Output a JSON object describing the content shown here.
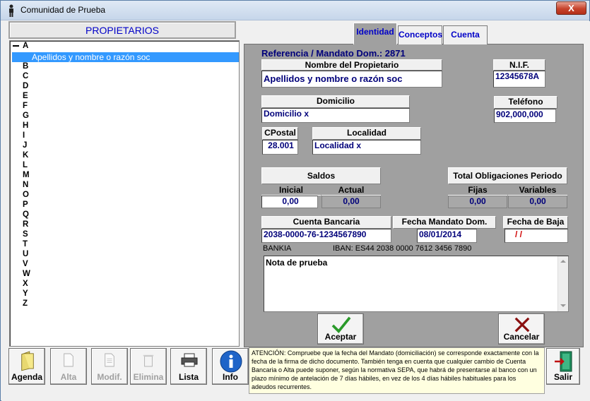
{
  "window": {
    "title": "Comunidad de Prueba",
    "close_label": "X"
  },
  "propietarios": {
    "header": "PROPIETARIOS",
    "root_letter": "A",
    "selected_item": "Apellidos y nombre o razón soc",
    "letters": [
      "B",
      "C",
      "D",
      "E",
      "F",
      "G",
      "H",
      "I",
      "J",
      "K",
      "L",
      "M",
      "N",
      "O",
      "P",
      "Q",
      "R",
      "S",
      "T",
      "U",
      "V",
      "W",
      "X",
      "Y",
      "Z"
    ]
  },
  "tabs": {
    "identidad": "Identidad",
    "conceptos": "Conceptos",
    "cuenta": "Cuenta"
  },
  "form": {
    "referencia": "Referencia / Mandato Dom.:  2871",
    "nombre_label": "Nombre del Propietario",
    "nombre_value": "Apellidos y nombre o razón soc",
    "nif_label": "N.I.F.",
    "nif_value": "12345678A",
    "domicilio_label": "Domicilio",
    "domicilio_value": "Domicilio x",
    "telefono_label": "Teléfono",
    "telefono_value": "902,000,000",
    "cpostal_label": "CPostal",
    "cpostal_value": "28.001",
    "localidad_label": "Localidad",
    "localidad_value": "Localidad x",
    "saldos_label": "Saldos",
    "inicial_label": "Inicial",
    "inicial_value": "0,00",
    "actual_label": "Actual",
    "actual_value": "0,00",
    "obligaciones_label": "Total Obligaciones Periodo",
    "fijas_label": "Fijas",
    "fijas_value": "0,00",
    "variables_label": "Variables",
    "variables_value": "0,00",
    "cuenta_label": "Cuenta Bancaria",
    "cuenta_value": "2038-0000-76-1234567890",
    "fecha_mandato_label": "Fecha Mandato Dom.",
    "fecha_mandato_value": "08/01/2014",
    "fecha_baja_label": "Fecha de Baja",
    "fecha_baja_value": "/ /",
    "banco": "BANKIA",
    "iban": "IBAN: ES44 2038 0000 7612 3456 7890",
    "nota": "Nota de prueba"
  },
  "buttons": {
    "aceptar": "Aceptar",
    "cancelar": "Cancelar",
    "agenda": "Agenda",
    "alta": "Alta",
    "modif": "Modif.",
    "elimina": "Elimina",
    "lista": "Lista",
    "info": "Info",
    "salir": "Salir"
  },
  "notice": "ATENCIÓN: Compruebe que la fecha del Mandato (domiciliación) se corresponde exactamente con la fecha de la firma de dicho documento. También tenga en cuenta que cualquier cambio de Cuenta Bancaria o Alta puede suponer, según la normativa SEPA, que habrá de presentarse al banco con un plazo mínimo de antelación de 7 días hábiles, en vez de los 4 días hábiles habituales para los adeudos recurrentes."
}
